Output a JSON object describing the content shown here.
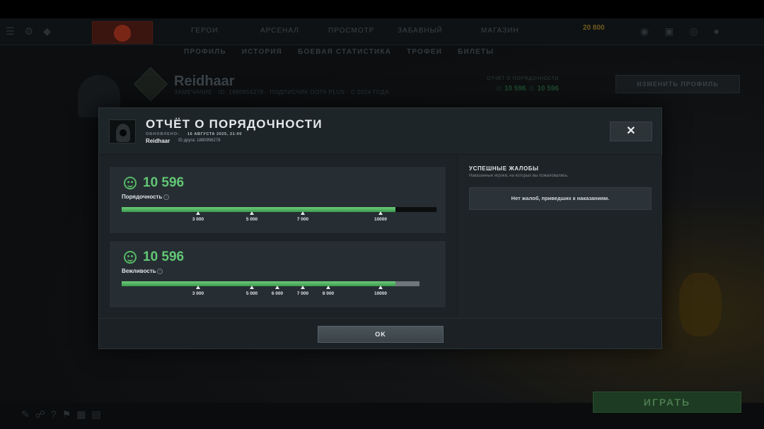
{
  "background": {
    "nav_items": [
      "ГЕРОИ",
      "АРСЕНАЛ",
      "ПРОСМОТР",
      "ЗАБАВНЫЙ",
      "МАГАЗИН"
    ],
    "gold": "20 800",
    "subnav": [
      "ПРОФИЛЬ",
      "ИСТОРИЯ",
      "БОЕВАЯ СТАТИСТИКА",
      "ТРОФЕИ",
      "БИЛЕТЫ"
    ],
    "player_name": "Reidhaar",
    "player_sub": "ЗАМЕЧАНИЕ  ·  ID: 1880956278  ·  ПОДПИСЧИК DOTA PLUS  ·  С 2024 ГОДА",
    "conduct_label": "ОТЧЁТ О ПОРЯДОЧНОСТИ",
    "conduct_values": "☺ 10 596   ☺ 10 596",
    "edit_profile": "ИЗМЕНИТЬ ПРОФИЛЬ",
    "play_label": "ИГРАТЬ"
  },
  "modal": {
    "title": "ОТЧЁТ О ПОРЯДОЧНОСТИ",
    "updated_label": "ОБНОВЛЕНО:",
    "updated_value": "16 АВГУСТА 2025, 21:00",
    "player_name": "Reidhaar",
    "friend_id": "ID друга: 1880956278",
    "close": "✕",
    "conduct": {
      "score": "10 596",
      "label": "Порядочность",
      "info": "i",
      "progress": 0.87,
      "ticks": [
        "3 000",
        "5 000",
        "7 000",
        "10000"
      ]
    },
    "politeness": {
      "score": "10 596",
      "label": "Вежливость",
      "info": "i",
      "progress": 0.92,
      "ticks": [
        "3 000",
        "5 000",
        "6 000",
        "7 000",
        "8 000",
        "10000"
      ]
    },
    "reports": {
      "title": "УСПЕШНЫЕ ЖАЛОБЫ",
      "subtitle": "Наказанные игроки, на которых вы пожаловались.",
      "empty": "Нет жалоб, приведших к наказаниям."
    },
    "ok": "OK"
  }
}
